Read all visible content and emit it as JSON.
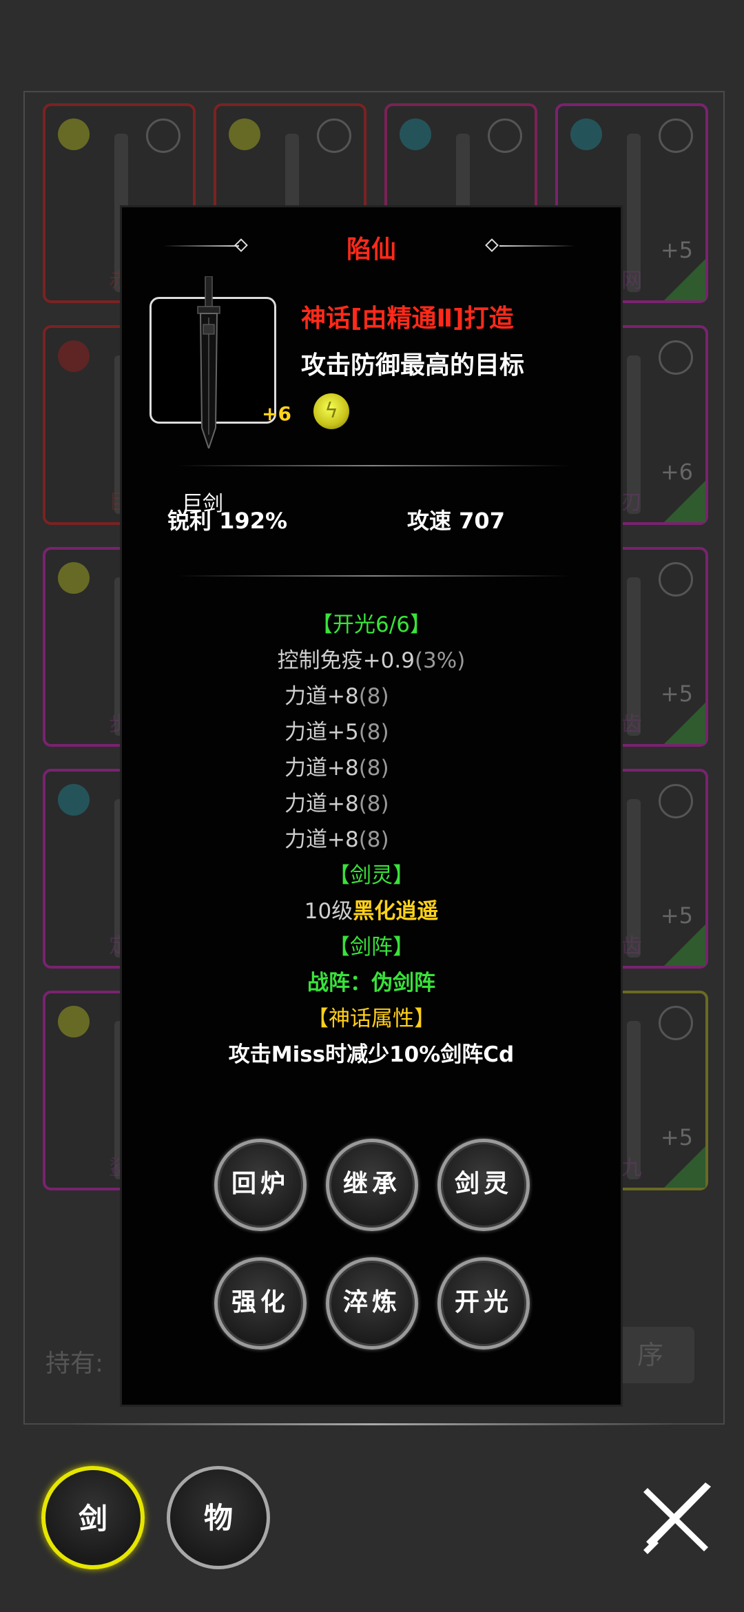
{
  "background": {
    "cards": [
      {
        "name": "赤",
        "border": "#7a2222",
        "gem": "#d9e21a"
      },
      {
        "name": "",
        "border": "#7a2222",
        "gem": "#d9e21a"
      },
      {
        "name": "",
        "border": "#7a2255",
        "gem": "#1aa3b5"
      },
      {
        "name": "网",
        "plus": "+5",
        "border": "#7a2270",
        "gem": "#1aa3b5"
      },
      {
        "name": "巨",
        "border": "#7a2222",
        "gem": "#c21a1a"
      },
      {
        "name": "刃",
        "plus": "+6",
        "border": "#7a2270",
        "gem": ""
      },
      {
        "name": "步",
        "border": "#7a2270",
        "gem": "#d9e21a"
      },
      {
        "name": "齿",
        "plus": "+5",
        "border": "#7a2270",
        "gem": ""
      },
      {
        "name": "定",
        "border": "#7a2270",
        "gem": "#1aa3b5"
      },
      {
        "name": "齿",
        "plus": "+5",
        "border": "#7a2270",
        "gem": ""
      },
      {
        "name": "鲨",
        "border": "#7a2270",
        "gem": "#d9e21a"
      },
      {
        "name": "九",
        "plus": "+5",
        "border": "#6a6a22",
        "gem": ""
      }
    ],
    "footer_label": "持有:",
    "sort_label": "序"
  },
  "popup": {
    "title": "陷仙",
    "weapon": {
      "plus": "+6",
      "type": "巨剑"
    },
    "forge": "神话[由精通Ⅱ]打造",
    "target": "攻击防御最高的目标",
    "element_icon": "lightning-gem-icon",
    "stats": {
      "sharp_label": "锐利",
      "sharp_value": "192%",
      "speed_label": "攻速",
      "speed_value": "707"
    },
    "kaiguang": {
      "header": "【开光6/6】",
      "lines": [
        {
          "text": "控制免疫+0.9",
          "extra": "(3%)"
        },
        {
          "text": "力道+8",
          "extra": "(8)"
        },
        {
          "text": "力道+5",
          "extra": "(8)"
        },
        {
          "text": "力道+8",
          "extra": "(8)"
        },
        {
          "text": "力道+8",
          "extra": "(8)"
        },
        {
          "text": "力道+8",
          "extra": "(8)"
        }
      ]
    },
    "spirit": {
      "header": "【剑灵】",
      "level": "10级",
      "name": "黑化逍遥"
    },
    "formation": {
      "header": "【剑阵】",
      "value": "战阵：伪剑阵"
    },
    "myth": {
      "header": "【神话属性】",
      "value": "攻击Miss时减少10%剑阵Cd"
    },
    "buttons": [
      "回炉",
      "继承",
      "剑灵",
      "强化",
      "淬炼",
      "开光"
    ]
  },
  "nav": {
    "sword": "剑",
    "item": "物",
    "close_icon": "crossed-swords-close-icon"
  },
  "colors": {
    "red": "#ff2a1a",
    "green": "#39e33a",
    "yellow": "#ffd21a"
  }
}
